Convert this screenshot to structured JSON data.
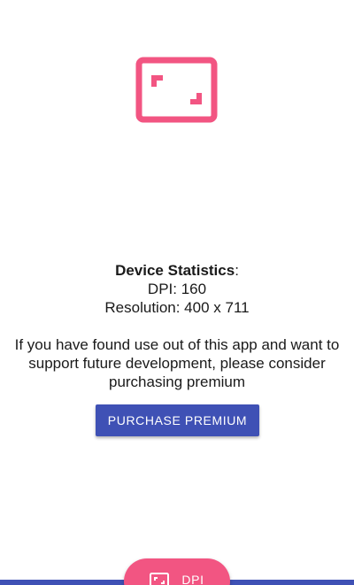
{
  "colors": {
    "accent": "#f25582",
    "primary": "#3f51b5",
    "background": "#ffffff",
    "text": "#1a1a1a"
  },
  "logo": {
    "icon": "fullscreen-icon"
  },
  "stats": {
    "heading": "Device Statistics",
    "heading_suffix": ":",
    "dpi": "DPI: 160",
    "resolution": "Resolution: 400 x 711"
  },
  "support_text": "If you have found use out of this app and want to support future development, please consider purchasing premium",
  "purchase_button_label": "PURCHASE PREMIUM",
  "fab": {
    "icon": "fullscreen-icon",
    "label": "DPI"
  }
}
